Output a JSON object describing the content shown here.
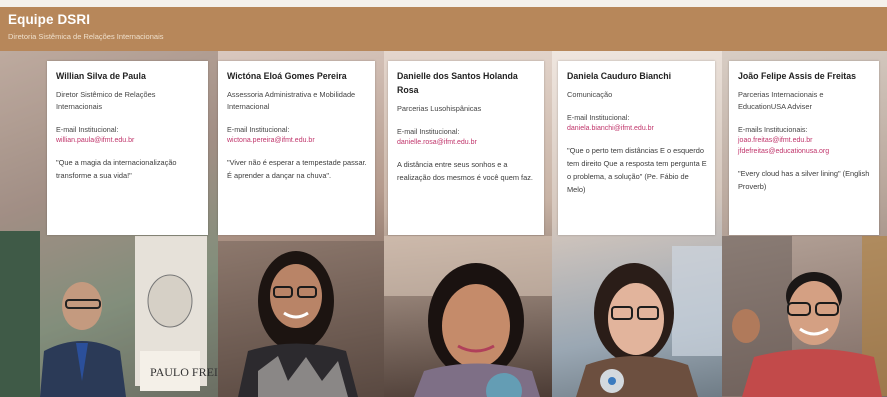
{
  "header": {
    "title": "Equipe DSRI",
    "subtitle": "Diretoria Sistêmica de Relações Internacionais"
  },
  "members": [
    {
      "name": "Willian Silva de Paula",
      "role": "Diretor Sistêmico de Relações Internacionais",
      "email_label": "E-mail Institucional:",
      "emails": [
        "willian.paula@ifmt.edu.br"
      ],
      "quote": "\"Que a magia da internacionalização transforme a sua vida!\""
    },
    {
      "name": "Wictóna Eloá Gomes Pereira",
      "role": "Assessoria Administrativa e Mobilidade Internacional",
      "email_label": "E-mail Institucional:",
      "emails": [
        "wictona.pereira@ifmt.edu.br"
      ],
      "quote": "\"Viver não é esperar a tempestade passar. É aprender a dançar na chuva\"."
    },
    {
      "name": "Danielle dos Santos Holanda Rosa",
      "role": "Parcerias Lusohispânicas",
      "email_label": "E-mail Institucional:",
      "emails": [
        "danielle.rosa@ifmt.edu.br"
      ],
      "quote": "A distância entre seus sonhos e a realização dos mesmos é você quem faz."
    },
    {
      "name": "Daniela Cauduro Bianchi",
      "role": "Comunicação",
      "email_label": "E-mail Institucional:",
      "emails": [
        "daniela.bianchi@ifmt.edu.br"
      ],
      "quote": "\"Que o perto tem distâncias E o esquerdo tem direito Que a resposta tem pergunta E o problema, a solução\" (Pe. Fábio de Melo)"
    },
    {
      "name": "João Felipe Assis de Freitas",
      "role": "Parcerias Internacionais e EducationUSA Adviser",
      "email_label": "E-mails Institucionais:",
      "emails": [
        "joao.freitas@ifmt.edu.br",
        "jfdefreitas@educationusa.org"
      ],
      "quote": "\"Every cloud has a silver lining\" (English Proverb)"
    }
  ]
}
